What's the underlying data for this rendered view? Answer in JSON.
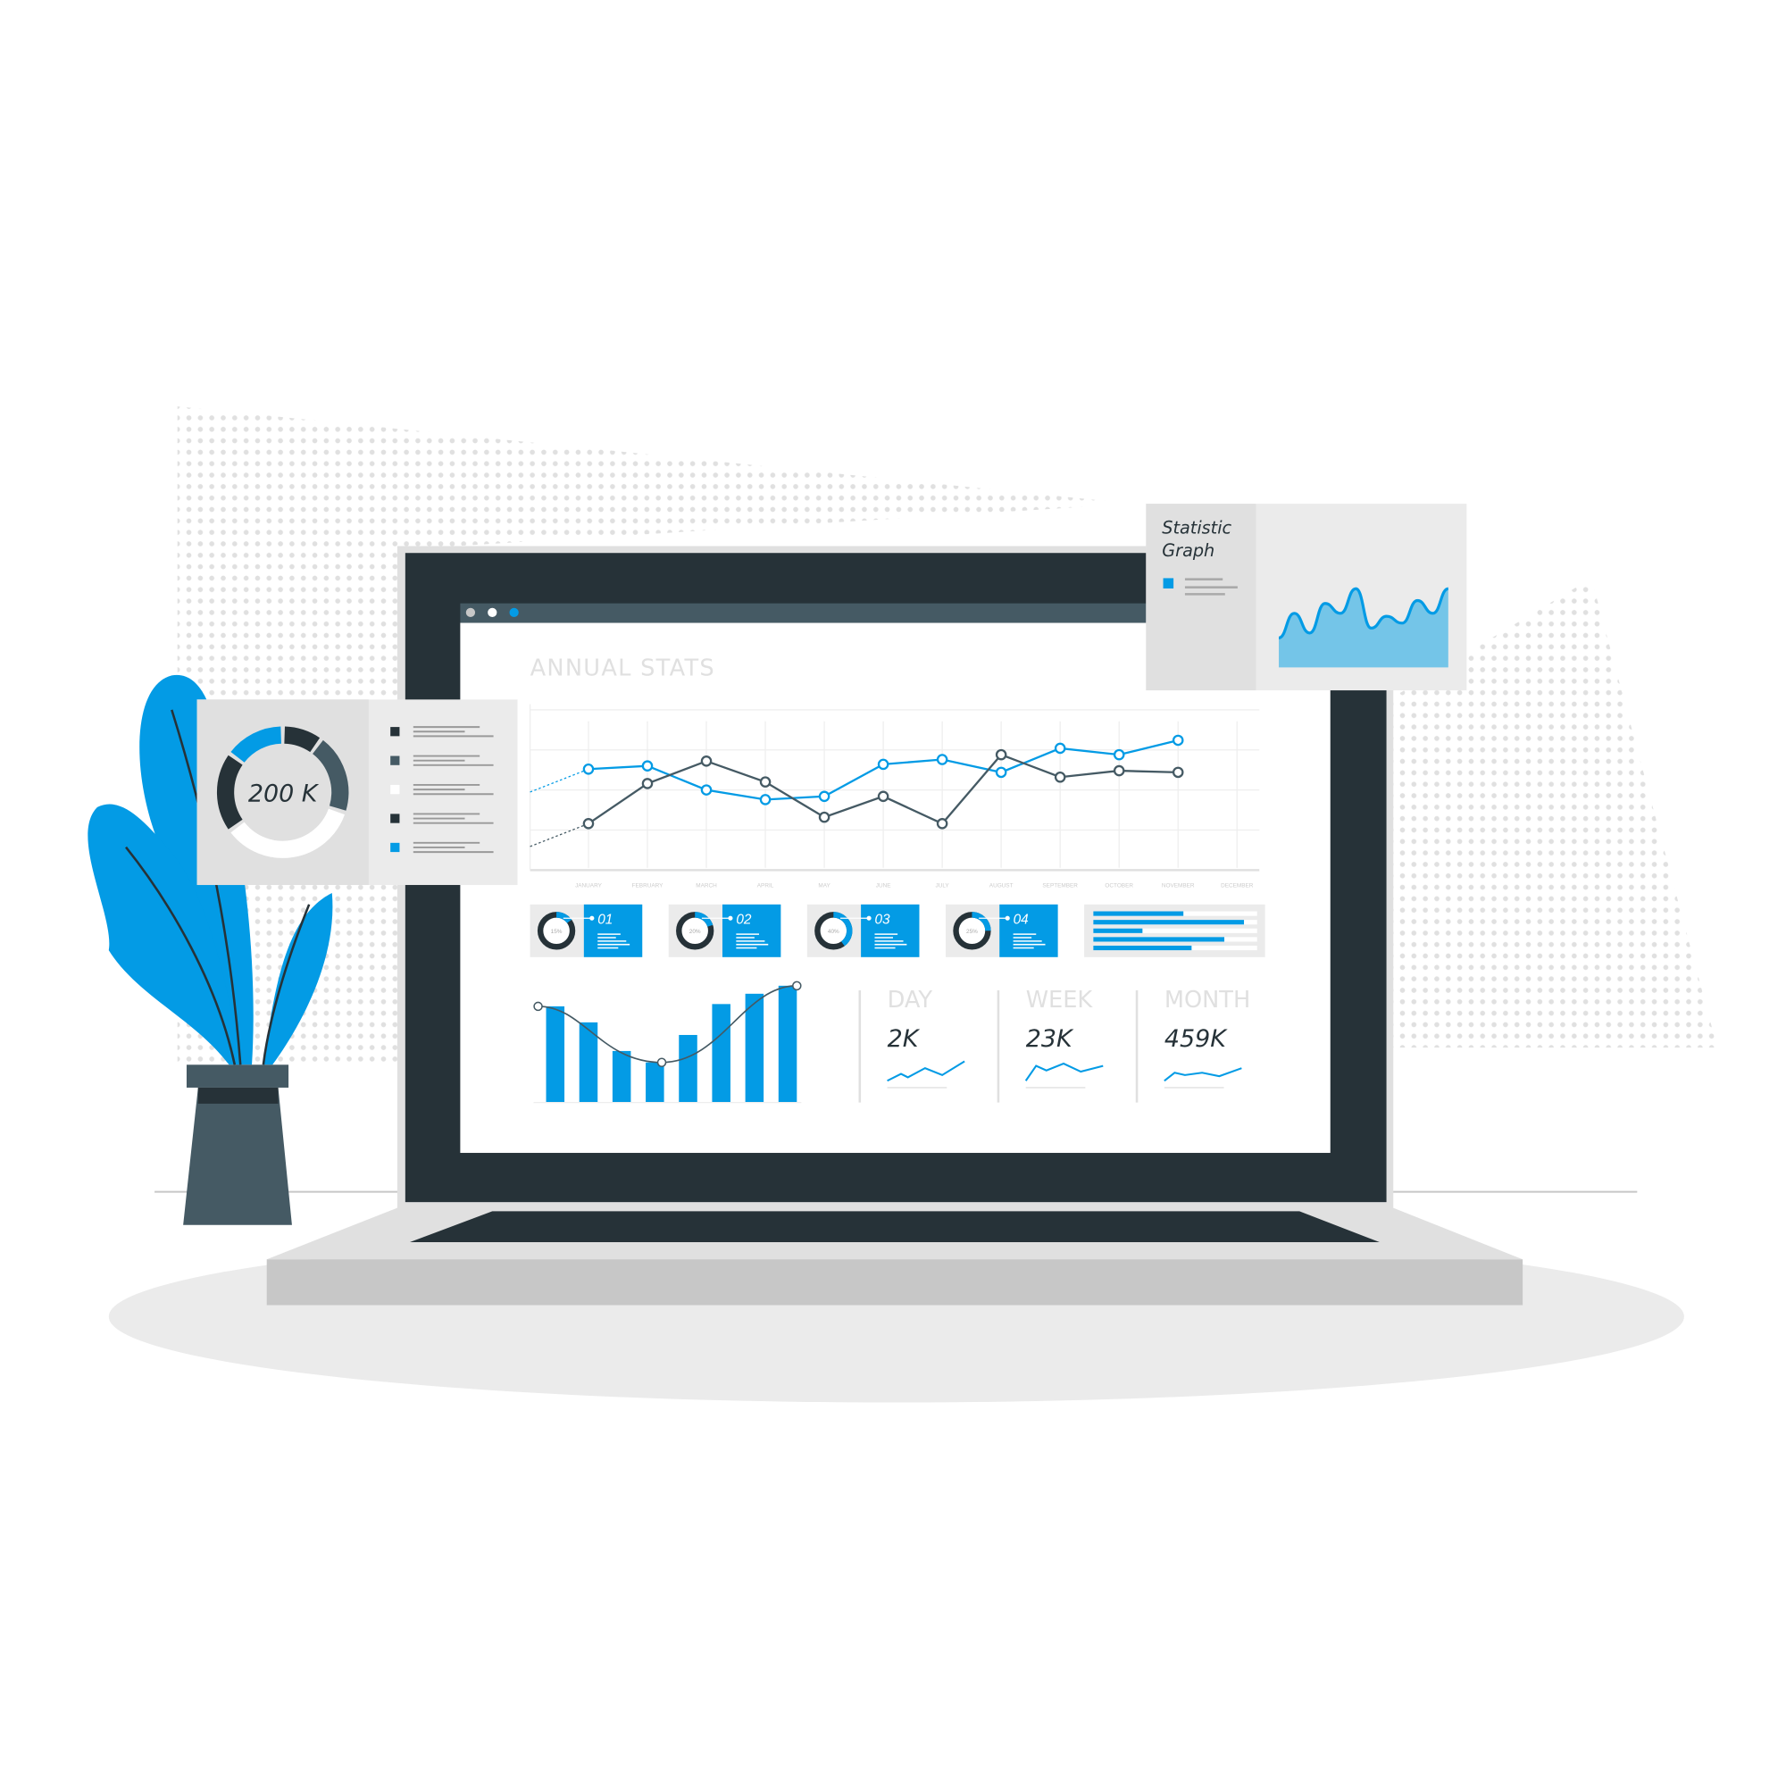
{
  "colors": {
    "accent": "#039be5",
    "dark": "#263238",
    "slate": "#455a64",
    "light_gray": "#e0e0e0",
    "panel_gray": "#ebebeb"
  },
  "window": {
    "dots": [
      "#c7c7c7",
      "#ffffff",
      "#039be5"
    ]
  },
  "dashboard": {
    "title": "ANNUAL STATS",
    "kpis": [
      {
        "label": "DAY",
        "value": "2K"
      },
      {
        "label": "WEEK",
        "value": "23K"
      },
      {
        "label": "MONTH",
        "value": "459K"
      }
    ],
    "cards": [
      {
        "number": "01",
        "percent": "15%",
        "fill": 15
      },
      {
        "number": "02",
        "percent": "20%",
        "fill": 20
      },
      {
        "number": "03",
        "percent": "40%",
        "fill": 40
      },
      {
        "number": "04",
        "percent": "25%",
        "fill": 25
      }
    ],
    "progress_bars": [
      55,
      92,
      30,
      80,
      60
    ]
  },
  "side_panel": {
    "donut_value": "200 K",
    "legend_colors": [
      "#263238",
      "#455a64",
      "#ffffff",
      "#263238",
      "#039be5"
    ]
  },
  "stat_panel": {
    "title_line1": "Statistic",
    "title_line2": "Graph"
  },
  "chart_data": [
    {
      "type": "line",
      "title": "ANNUAL STATS",
      "categories": [
        "JANUARY",
        "FEBRUARY",
        "MARCH",
        "APRIL",
        "MAY",
        "JUNE",
        "JULY",
        "AUGUST",
        "SEPTEMBER",
        "OCTOBER",
        "NOVEMBER",
        "DECEMBER"
      ],
      "series": [
        {
          "color": "#039be5",
          "values": [
            63,
            65,
            50,
            44,
            46,
            66,
            69,
            61,
            76,
            72,
            81
          ]
        },
        {
          "color": "#455a64",
          "values": [
            29,
            54,
            68,
            55,
            33,
            46,
            29,
            72,
            58,
            62,
            61
          ]
        }
      ],
      "ylim": [
        0,
        100
      ],
      "grid": true
    },
    {
      "type": "bar",
      "values": [
        84,
        70,
        45,
        35,
        59,
        86,
        95,
        102
      ],
      "overlay_line": true,
      "ylim": [
        0,
        110
      ]
    },
    {
      "type": "area",
      "values": [
        30,
        55,
        35,
        65,
        55,
        80,
        40,
        52,
        45,
        68,
        55,
        80
      ],
      "ylim": [
        0,
        100
      ]
    },
    {
      "type": "pie",
      "title": "200 K",
      "values": [
        10,
        20,
        35,
        20,
        15
      ]
    }
  ]
}
